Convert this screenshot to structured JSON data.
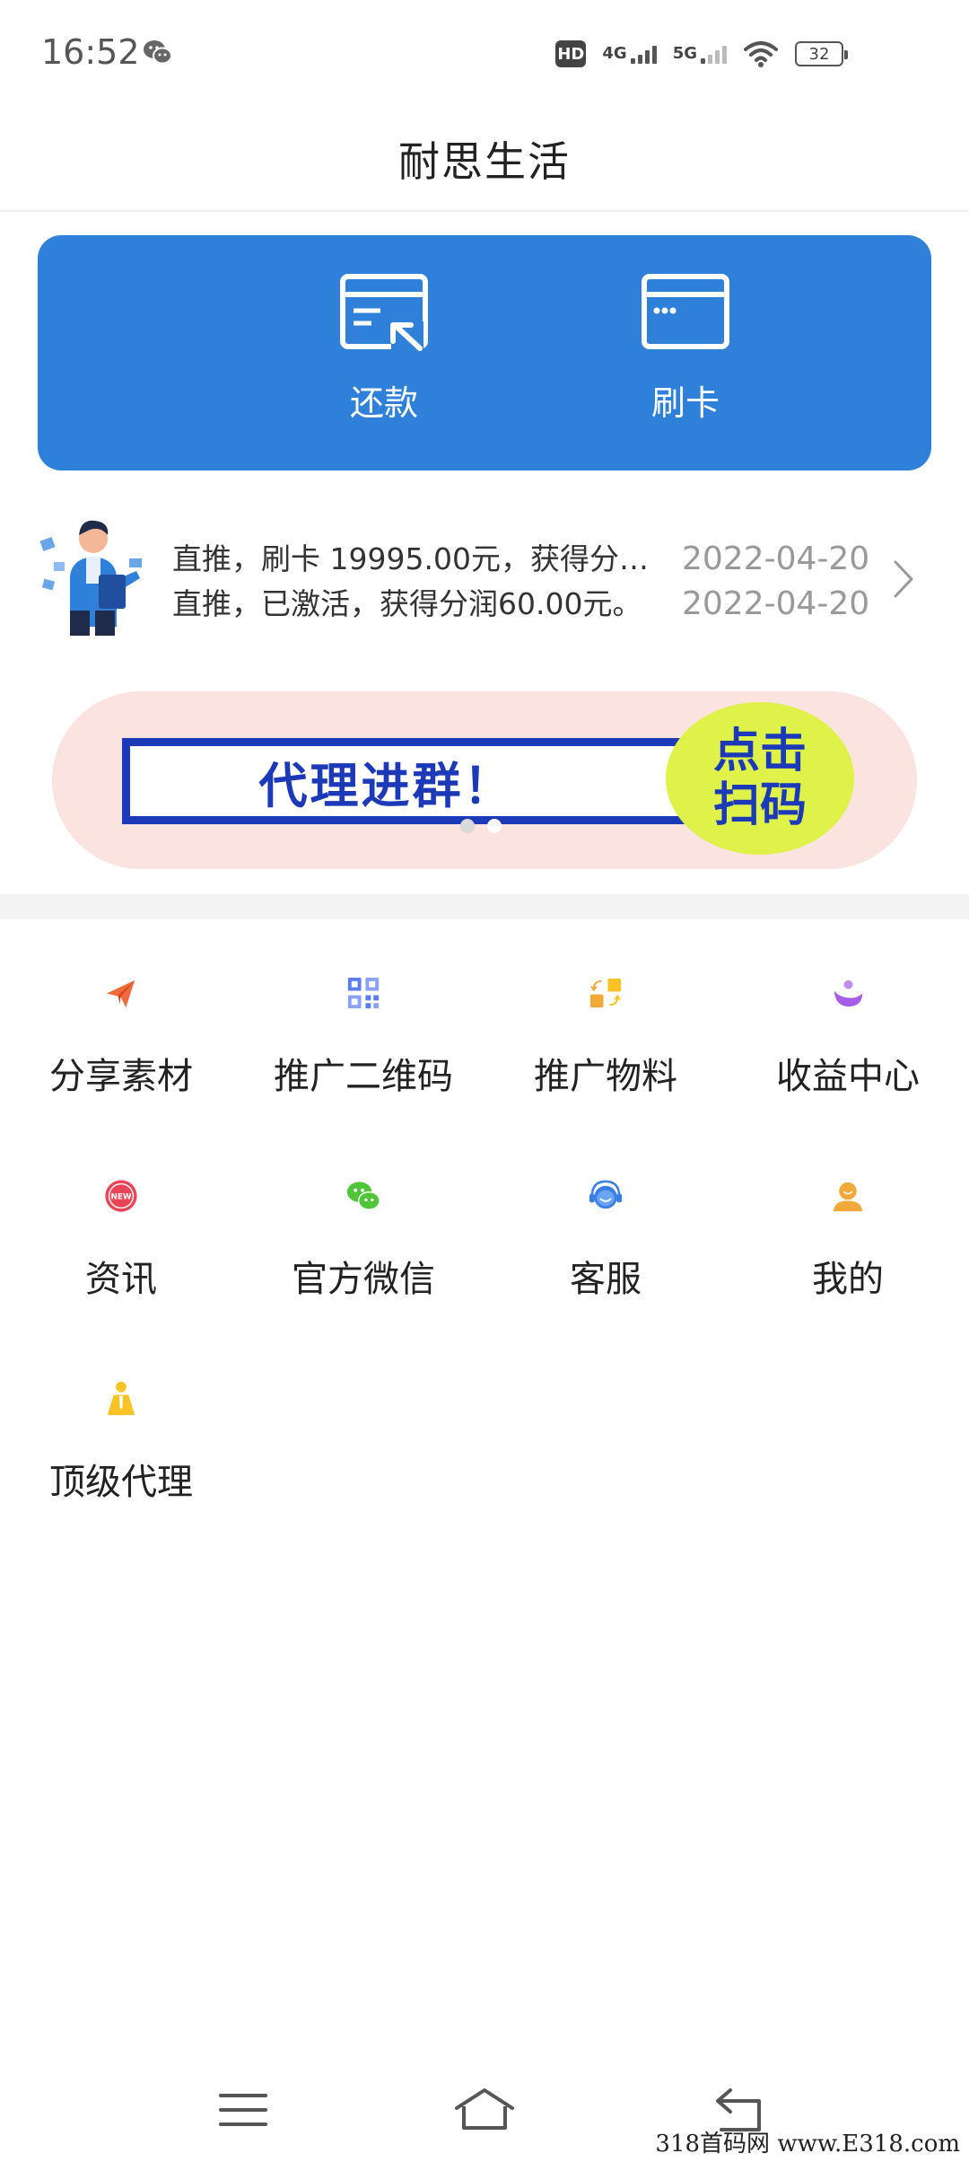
{
  "status_bar": {
    "time": "16:52",
    "hd": "HD",
    "net1": "4G",
    "net2": "5G",
    "battery": "32"
  },
  "header": {
    "title": "耐思生活"
  },
  "actions": [
    {
      "label": "还款",
      "icon": "card-repay-icon"
    },
    {
      "label": "刷卡",
      "icon": "card-swipe-icon"
    }
  ],
  "notice": {
    "lines": [
      {
        "text": "直推，刷卡 19995.00元，获得分…",
        "date": "2022-04-20"
      },
      {
        "text": "直推，已激活，获得分润60.00元。",
        "date": "2022-04-20"
      }
    ]
  },
  "banner": {
    "text": "代理进群！",
    "cta": "点击扫码",
    "colors": {
      "background": "#fbe3df",
      "frame": "#1c3ab8",
      "cta": "#dff24a"
    }
  },
  "menu": [
    {
      "label": "分享素材",
      "icon": "paper-plane-icon"
    },
    {
      "label": "推广二维码",
      "icon": "qrcode-icon"
    },
    {
      "label": "推广物料",
      "icon": "exchange-icon"
    },
    {
      "label": "收益中心",
      "icon": "earnings-icon"
    },
    {
      "label": "资讯",
      "icon": "new-badge-icon"
    },
    {
      "label": "官方微信",
      "icon": "wechat-icon"
    },
    {
      "label": "客服",
      "icon": "customer-service-icon"
    },
    {
      "label": "我的",
      "icon": "user-icon"
    },
    {
      "label": "顶级代理",
      "icon": "agent-icon"
    }
  ],
  "watermark": "318首码网 www.E318.com",
  "theme": {
    "primary": "#2f80d9"
  }
}
